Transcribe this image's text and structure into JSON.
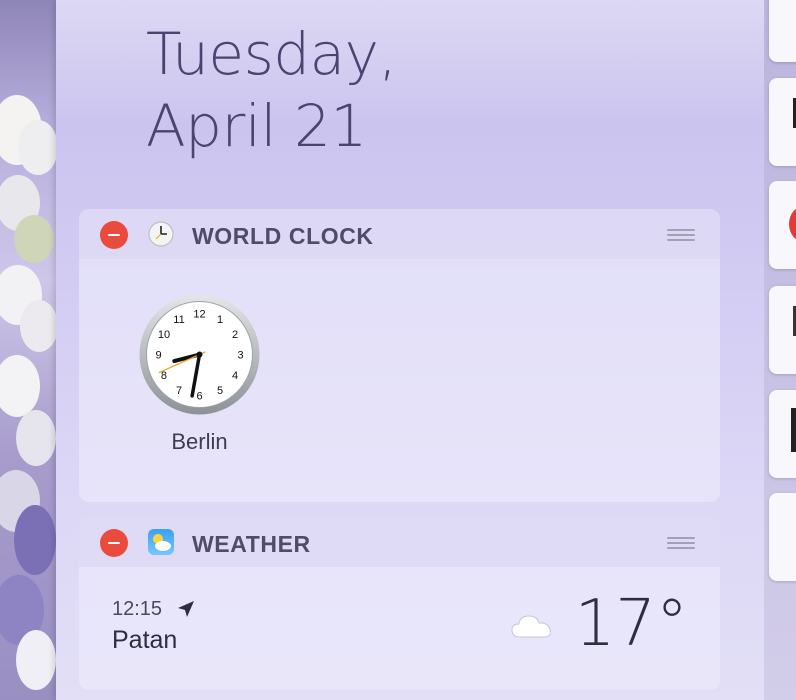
{
  "date": {
    "weekday": "Tuesday,",
    "day": "April 21"
  },
  "widgets": {
    "world_clock": {
      "title": "WORLD CLOCK",
      "icon": "clock-app-icon",
      "clocks": [
        {
          "city": "Berlin",
          "hour": 8,
          "minute": 31,
          "second": 41
        }
      ],
      "numerals": [
        "12",
        "1",
        "2",
        "3",
        "4",
        "5",
        "6",
        "7",
        "8",
        "9",
        "10",
        "11"
      ]
    },
    "weather": {
      "title": "WEATHER",
      "icon": "weather-app-icon",
      "time": "12:15",
      "city": "Patan",
      "condition_icon": "cloud-icon",
      "temperature": "17°"
    }
  },
  "colors": {
    "remove_button": "#ea4b3c",
    "text_primary": "#2e2c40"
  }
}
